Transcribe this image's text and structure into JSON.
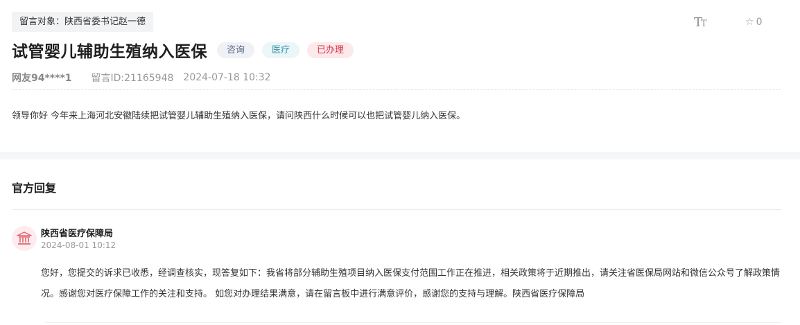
{
  "header": {
    "target_label": "留言对象：陕西省委书记赵一德",
    "font_icon_big": "T",
    "font_icon_small": "T",
    "favorite_icon": "☆",
    "favorite_count": "0"
  },
  "message": {
    "title": "试管婴儿辅助生殖纳入医保",
    "badges": [
      "咨询",
      "医疗",
      "已办理"
    ],
    "user": "网友94****1",
    "message_id": "留言ID:21165948",
    "date": "2024-07-18 10:32",
    "content": "领导你好 今年来上海河北安徽陆续把试管婴儿辅助生殖纳入医保，请问陕西什么时候可以也把试管婴儿纳入医保。"
  },
  "reply": {
    "section_title": "官方回复",
    "org_name": "陕西省医疗保障局",
    "time": "2024-08-01 10:12",
    "text": "您好，您提交的诉求已收悉，经调查核实，现答复如下：我省将部分辅助生殖项目纳入医保支付范围工作正在推进，相关政策将于近期推出，请关注省医保局网站和微信公众号了解政策情况。感谢您对医疗保障工作的关注和支持。 如您对办理结果满意，请在留言板中进行满意评价，感谢您的支持与理解。陕西省医疗保障局"
  },
  "colors": {
    "badge_consult": "#5a6b8a",
    "badge_medical": "#3a8fa8",
    "badge_done": "#d4374a",
    "avatar_icon": "#e06470"
  }
}
